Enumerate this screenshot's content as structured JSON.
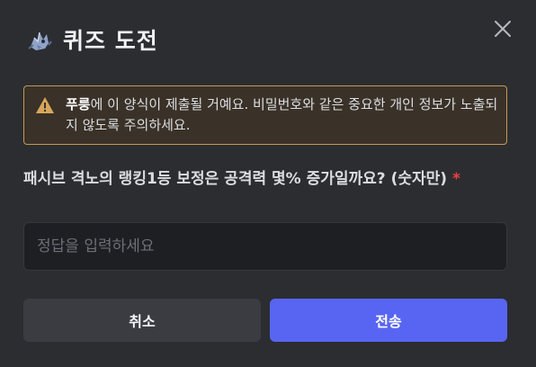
{
  "modal": {
    "title": "퀴즈 도전",
    "icon": "dragon-bot-icon",
    "close_icon": "close-icon"
  },
  "warning": {
    "icon": "warning-icon",
    "app_name": "푸룽",
    "message": "에 이 양식이 제출될 거예요. 비밀번호와 같은 중요한 개인 정보가 노출되지 않도록 주의하세요."
  },
  "question": {
    "label": "패시브 격노의 랭킹1등 보정은 공격력 몇% 증가일까요? (숫자만)",
    "required_mark": "*"
  },
  "answer": {
    "value": "",
    "placeholder": "정답을 입력하세요"
  },
  "buttons": {
    "cancel_label": "취소",
    "submit_label": "전송"
  },
  "colors": {
    "background": "#2b2d31",
    "warning_border": "#c29a52",
    "warning_bg": "#3a3128",
    "primary": "#5865f2",
    "required": "#f23f43"
  }
}
